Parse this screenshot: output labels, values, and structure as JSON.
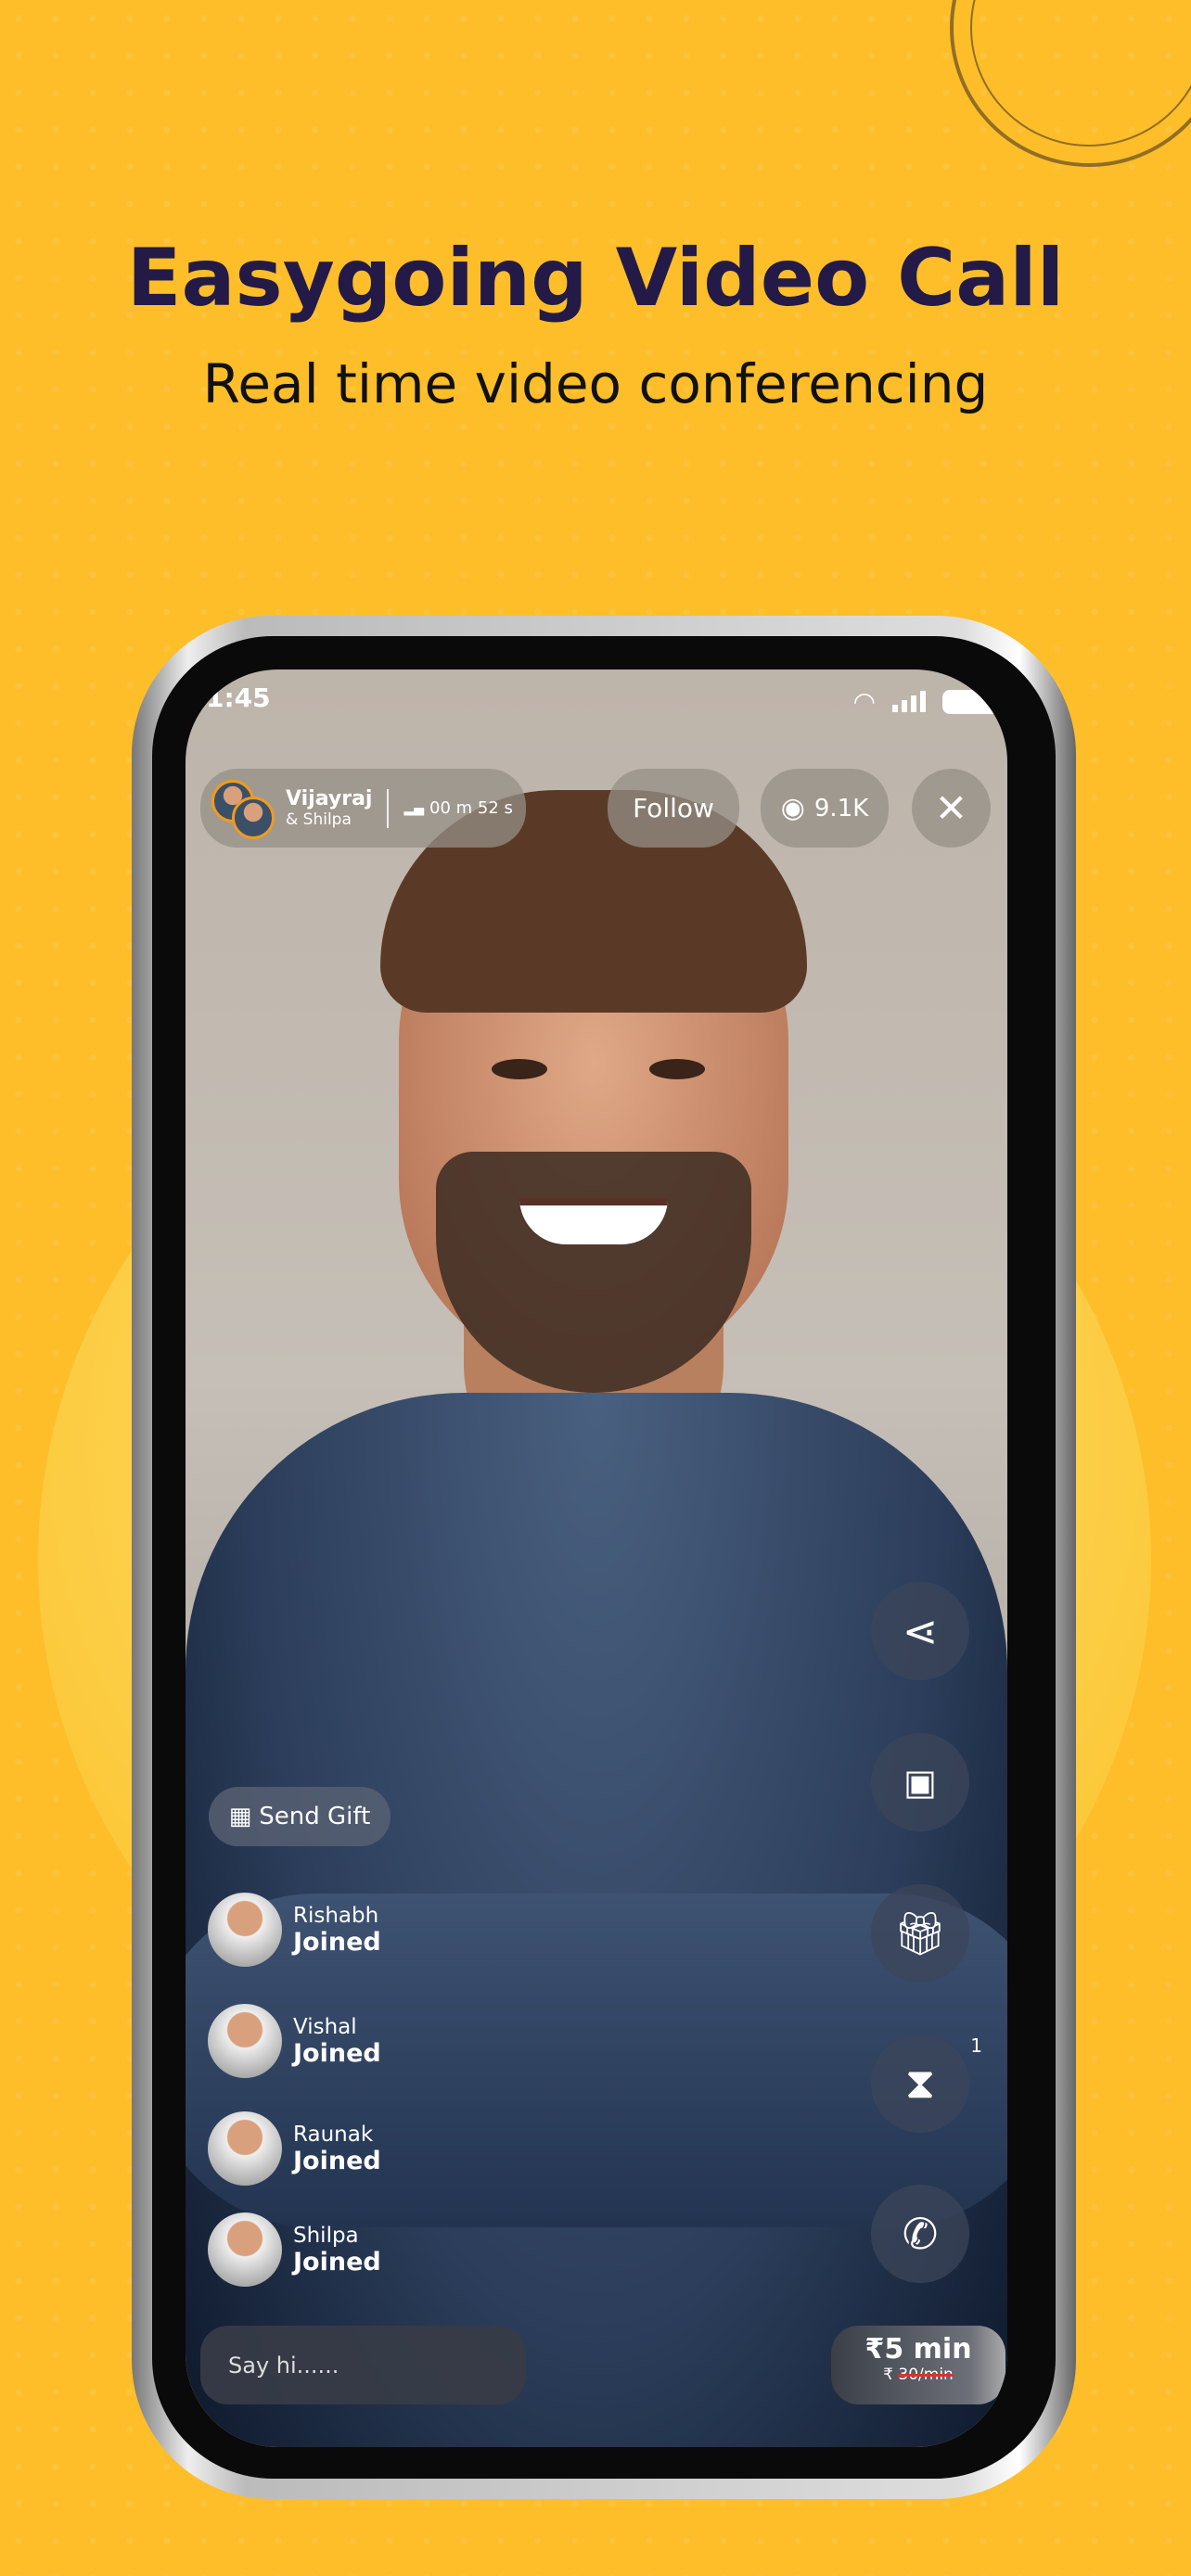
{
  "header": {
    "title": "Easygoing Video Call",
    "subtitle": "Real time video conferencing"
  },
  "status_bar": {
    "time": "1:45"
  },
  "host": {
    "name": "Vijayraj",
    "co_host": "& Shilpa",
    "duration": "00 m 52 s"
  },
  "top_actions": {
    "follow_label": "Follow",
    "views": "9.1K",
    "close_icon": "close-icon"
  },
  "side_actions": [
    {
      "icon": "share-icon"
    },
    {
      "icon": "wallet-icon"
    },
    {
      "icon": "gift-icon"
    },
    {
      "icon": "hourglass-icon",
      "badge": "1"
    },
    {
      "icon": "phone-icon"
    }
  ],
  "send_gift_label": "Send Gift",
  "joined": [
    {
      "name": "Rishabh",
      "status": "Joined"
    },
    {
      "name": "Vishal",
      "status": "Joined"
    },
    {
      "name": "Raunak",
      "status": "Joined"
    },
    {
      "name": "Shilpa",
      "status": "Joined"
    }
  ],
  "chat": {
    "placeholder": "Say hi......"
  },
  "price": {
    "current": "₹5 min",
    "currency": "₹",
    "old": "30/min"
  },
  "colors": {
    "background": "#FDBE2A",
    "title": "#231A47",
    "avatar_ring": "#F29A1E"
  }
}
